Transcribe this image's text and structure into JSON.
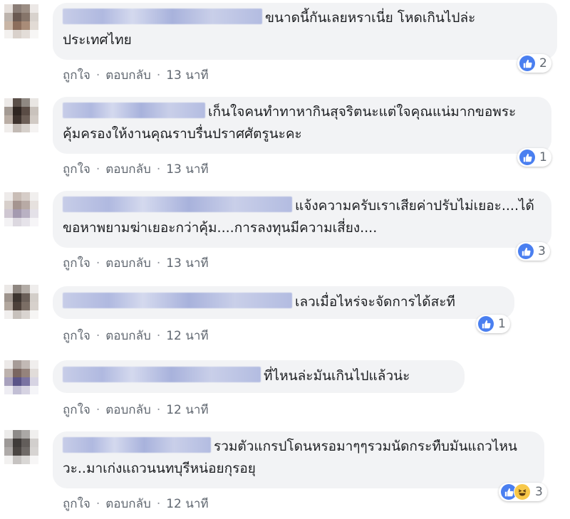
{
  "actions": {
    "like": "ถูกใจ",
    "reply": "ตอบกลับ",
    "sep": "·"
  },
  "colors": {
    "like_blue": "#4a7ff0",
    "meta_gray": "#606770",
    "bubble_bg": "#f2f3f5"
  },
  "comments": [
    {
      "text": "ขนาดนี้กันเลยหราเนี่ย โหดเกินไปล่ะประเทศไทย",
      "time": "13 นาที",
      "reactions": {
        "types": [
          "like"
        ],
        "count": "2"
      }
    },
    {
      "text": "เก็นใจคนทำทาหากินสุจริตนะแต่ใจคุณแน่มากขอพระคุ้มครองให้งานคุณราบรื่นปราศศัตรูนะคะ",
      "time": "13 นาที",
      "reactions": {
        "types": [
          "like"
        ],
        "count": "1"
      }
    },
    {
      "text": "แจ้งความครับเราเสียค่าปรับไม่เยอะ....ได้ขอหาพยามฆ่าเยอะกว่าคุ้ม....การลงทุนมีความเสี่ยง....",
      "time": "13 นาที",
      "reactions": {
        "types": [
          "like"
        ],
        "count": "3"
      }
    },
    {
      "text": "เลวเมื่อไหร่จะจัดการได้สะที",
      "time": "12 นาที",
      "reactions": {
        "types": [
          "like"
        ],
        "count": "1"
      }
    },
    {
      "text": "ที่ไหนล่ะมันเกินไปแล้วน่ะ",
      "time": "12 นาที",
      "reactions": null
    },
    {
      "text": "รวมตัวแกรปโดนหรอมาๆๆรวมนัดกระทืบมันแถวไหนวะ..มาเก่งแถวนนทบุรีหน่อยกุรอยุ",
      "time": "12 นาที",
      "reactions": {
        "types": [
          "like",
          "haha"
        ],
        "count": "3"
      }
    }
  ]
}
